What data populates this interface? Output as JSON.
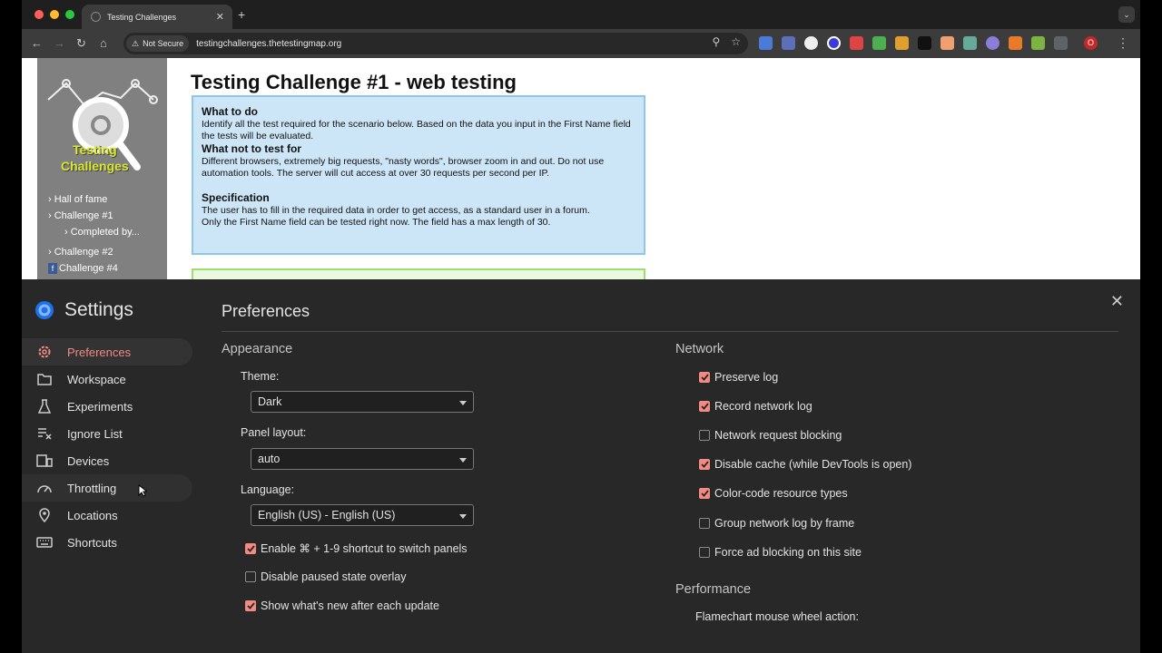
{
  "browser": {
    "tab_title": "Testing Challenges",
    "security_label": "Not Secure",
    "url": "testingchallenges.thetestingmap.org",
    "profile_letter": "O"
  },
  "site": {
    "logo_line1": "Testing",
    "logo_line2": "Challenges",
    "nav": {
      "hall_of_fame": "Hall of fame",
      "challenge1": "Challenge #1",
      "completed_by": "Completed by...",
      "challenge2": "Challenge #2",
      "challenge4": "Challenge #4"
    },
    "page_title": "Testing Challenge #1 - web testing",
    "what_to_do_title": "What to do",
    "what_to_do_text": "Identify all the test required for the scenario below. Based on the data you input in the First Name field the tests will be evaluated.",
    "what_not_title": "What not to test for",
    "what_not_text": "Different browsers, extremely big requests, \"nasty words\", browser zoom in and out. Do not use automation tools. The server will cut access at over 30 requests per second per IP.",
    "spec_title": "Specification",
    "spec_text1": "The user has to fill in the required data in order to get access, as a standard user in a forum.",
    "spec_text2": "Only the First Name field can be tested right now. The field has a max length of 30."
  },
  "devtools": {
    "settings_title": "Settings",
    "nav": [
      {
        "label": "Preferences",
        "icon": "gear-icon"
      },
      {
        "label": "Workspace",
        "icon": "folder-icon"
      },
      {
        "label": "Experiments",
        "icon": "flask-icon"
      },
      {
        "label": "Ignore List",
        "icon": "ignore-list-icon"
      },
      {
        "label": "Devices",
        "icon": "devices-icon"
      },
      {
        "label": "Throttling",
        "icon": "speedometer-icon"
      },
      {
        "label": "Locations",
        "icon": "location-pin-icon"
      },
      {
        "label": "Shortcuts",
        "icon": "keyboard-icon"
      }
    ],
    "page_title": "Preferences",
    "appearance": {
      "title": "Appearance",
      "theme_label": "Theme:",
      "theme_value": "Dark",
      "panel_layout_label": "Panel layout:",
      "panel_layout_value": "auto",
      "language_label": "Language:",
      "language_value": "English (US) - English (US)",
      "options": [
        {
          "label": "Enable ⌘ + 1-9 shortcut to switch panels",
          "checked": true
        },
        {
          "label": "Disable paused state overlay",
          "checked": false
        },
        {
          "label": "Show what's new after each update",
          "checked": true
        }
      ]
    },
    "network": {
      "title": "Network",
      "options": [
        {
          "label": "Preserve log",
          "checked": true
        },
        {
          "label": "Record network log",
          "checked": true
        },
        {
          "label": "Network request blocking",
          "checked": false
        },
        {
          "label": "Disable cache (while DevTools is open)",
          "checked": true
        },
        {
          "label": "Color-code resource types",
          "checked": true
        },
        {
          "label": "Group network log by frame",
          "checked": false
        },
        {
          "label": "Force ad blocking on this site",
          "checked": false
        }
      ]
    },
    "performance": {
      "title": "Performance",
      "flamechart_label": "Flamechart mouse wheel action:"
    },
    "accent_color": "#f28b82"
  }
}
